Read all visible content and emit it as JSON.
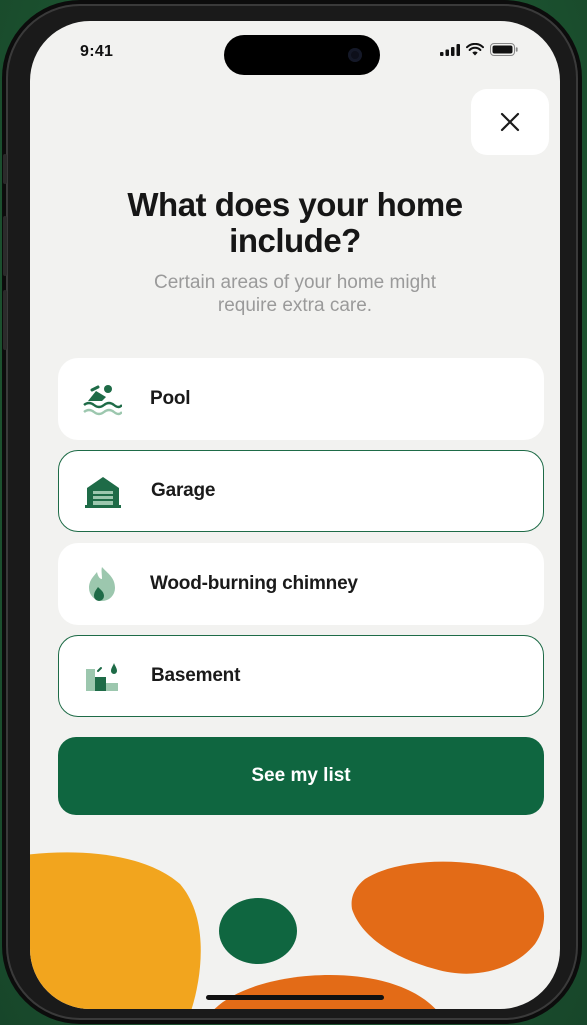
{
  "status_bar": {
    "time": "9:41",
    "icons": [
      "signal-icon",
      "wifi-icon",
      "battery-icon"
    ]
  },
  "close_button": {
    "icon": "close-icon"
  },
  "header": {
    "title_line1": "What does your home",
    "title_line2": "include?",
    "subtitle_line1": "Certain areas of your home might",
    "subtitle_line2": "require extra care."
  },
  "options": [
    {
      "label": "Pool",
      "icon": "pool-icon",
      "selected": false
    },
    {
      "label": "Garage",
      "icon": "garage-icon",
      "selected": true
    },
    {
      "label": "Wood-burning chimney",
      "icon": "fire-icon",
      "selected": false
    },
    {
      "label": "Basement",
      "icon": "basement-icon",
      "selected": true
    }
  ],
  "cta": {
    "label": "See my list"
  },
  "colors": {
    "brand_green": "#0f6640",
    "selected_border": "#1e6b47",
    "icon_green": "#1e6b47",
    "icon_light_green": "#9cc7ae",
    "blob_yellow": "#f2a51e",
    "blob_orange": "#e36b17",
    "background": "#f2f2f0"
  }
}
